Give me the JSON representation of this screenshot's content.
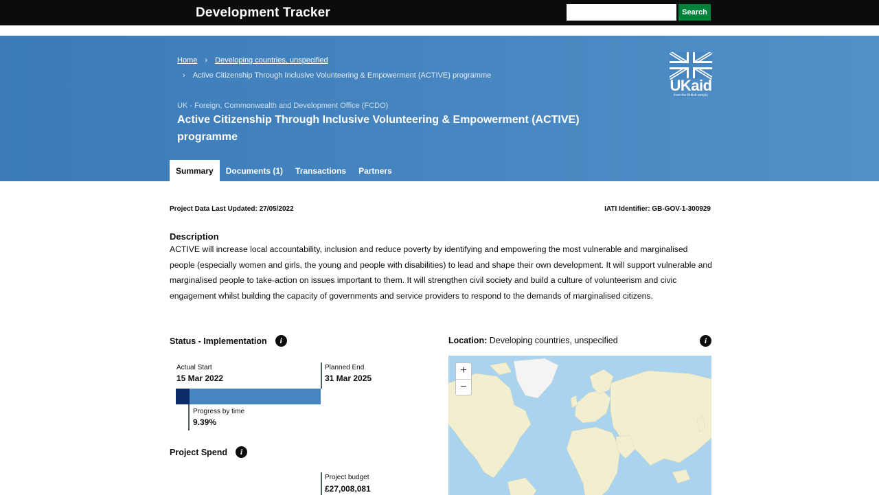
{
  "topbar": {
    "brand": "Development Tracker",
    "search_placeholder": "",
    "search_button": "Search"
  },
  "breadcrumb": {
    "home": "Home",
    "country": "Developing countries, unspecified",
    "current": "Active Citizenship Through Inclusive Volunteering & Empowerment (ACTIVE) programme"
  },
  "header": {
    "organisation": "UK - Foreign, Commonwealth and Development Office (FCDO)",
    "title": "Active Citizenship Through Inclusive Volunteering & Empowerment (ACTIVE) programme",
    "logo_text": "UKaid",
    "logo_tagline": "from the British people"
  },
  "tabs": [
    {
      "label": "Summary",
      "active": true
    },
    {
      "label": "Documents (1)",
      "active": false
    },
    {
      "label": "Transactions",
      "active": false
    },
    {
      "label": "Partners",
      "active": false
    }
  ],
  "meta": {
    "last_updated": "Project Data Last Updated: 27/05/2022",
    "iati": "IATI Identifier: GB-GOV-1-300929"
  },
  "description": {
    "heading": "Description",
    "text": "ACTIVE will increase local accountability, inclusion and reduce poverty by identifying and empowering the most vulnerable and marginalised people (especially women and girls, the young and people with disabilities) to lead and shape their own development. It will support vulnerable and marginalised people to take-action on issues important to them. It will strengthen civil society and build a culture of volunteerism and civic engagement whilst building the capacity of governments and service providers to respond to the demands of marginalised citizens."
  },
  "status": {
    "heading": "Status - Implementation",
    "actual_start_label": "Actual Start",
    "actual_start": "15 Mar 2022",
    "planned_end_label": "Planned End",
    "planned_end": "31 Mar 2025",
    "progress_label": "Progress by time",
    "progress_text": "9.39%",
    "progress_fraction": 0.0939
  },
  "spend": {
    "heading": "Project Spend",
    "budget_label": "Project budget",
    "budget": "£27,008,081"
  },
  "location": {
    "label": "Location:",
    "value": "Developing countries, unspecified"
  },
  "map": {
    "zoom_in": "+",
    "zoom_out": "−",
    "ocean_color": "#a9d3ef",
    "land_color": "#f2efd0",
    "ice_color": "#f4f4f4"
  },
  "colors": {
    "topbar": "#0b0c0c",
    "header_blue": "#4685c0",
    "search_green": "#00823b",
    "progress_dark": "#0b2a6a"
  }
}
